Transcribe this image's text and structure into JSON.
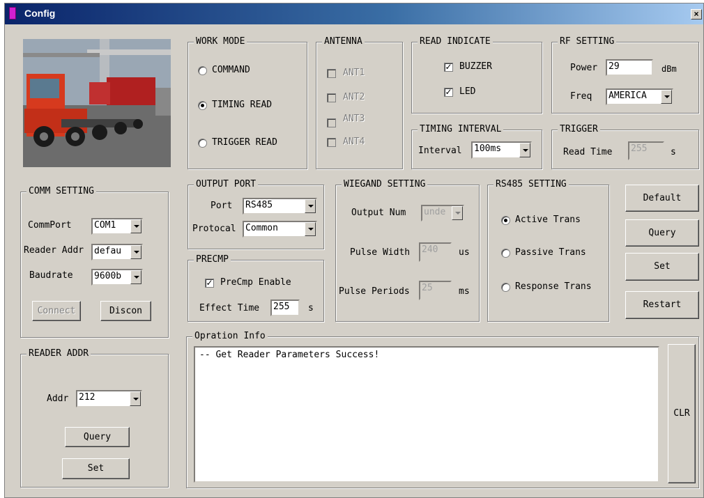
{
  "window": {
    "title": "Config",
    "close_label": "×"
  },
  "work_mode": {
    "title": "WORK MODE",
    "options": [
      "COMMAND",
      "TIMING READ",
      "TRIGGER READ"
    ],
    "selected": "TIMING READ"
  },
  "antenna": {
    "title": "ANTENNA",
    "items": [
      "ANT1",
      "ANT2",
      "ANT3",
      "ANT4"
    ]
  },
  "read_indicate": {
    "title": "READ INDICATE",
    "buzzer": "BUZZER",
    "led": "LED",
    "buzzer_checked": true,
    "led_checked": true
  },
  "rf_setting": {
    "title": "RF SETTING",
    "power_label": "Power",
    "power_value": "29",
    "power_unit": "dBm",
    "freq_label": "Freq",
    "freq_value": "AMERICA"
  },
  "timing_interval": {
    "title": "TIMING INTERVAL",
    "label": "Interval",
    "value": "100ms"
  },
  "trigger": {
    "title": "TRIGGER",
    "label": "Read Time",
    "value": "255",
    "unit": "s"
  },
  "comm_setting": {
    "title": "COMM SETTING",
    "commport_label": "CommPort",
    "commport_value": "COM1",
    "reader_addr_label": "Reader Addr",
    "reader_addr_value": "defau",
    "baudrate_label": "Baudrate",
    "baudrate_value": "9600b",
    "connect": "Connect",
    "discon": "Discon"
  },
  "output_port": {
    "title": "OUTPUT PORT",
    "port_label": "Port",
    "port_value": "RS485",
    "protocol_label": "Protocal",
    "protocol_value": "Common"
  },
  "precmp": {
    "title": "PRECMP",
    "enable_label": "PreCmp Enable",
    "enable_checked": true,
    "effect_label": "Effect Time",
    "effect_value": "255",
    "effect_unit": "s"
  },
  "wiegand": {
    "title": "WIEGAND SETTING",
    "output_num_label": "Output Num",
    "output_num_value": "unde",
    "pulse_width_label": "Pulse Width",
    "pulse_width_value": "240",
    "pulse_width_unit": "us",
    "pulse_periods_label": "Pulse Periods",
    "pulse_periods_value": "25",
    "pulse_periods_unit": "ms"
  },
  "rs485": {
    "title": "RS485 SETTING",
    "options": [
      "Active Trans",
      "Passive Trans",
      "Response Trans"
    ],
    "selected": "Active Trans"
  },
  "actions": {
    "default": "Default",
    "query": "Query",
    "set": "Set",
    "restart": "Restart"
  },
  "reader_addr": {
    "title": "READER ADDR",
    "addr_label": "Addr",
    "addr_value": "212",
    "query": "Query",
    "set": "Set"
  },
  "operation_info": {
    "title": "Opration Info",
    "text": "-- Get Reader Parameters Success!",
    "clr": "CLR"
  },
  "photo": {
    "icon": "truck-photo"
  }
}
